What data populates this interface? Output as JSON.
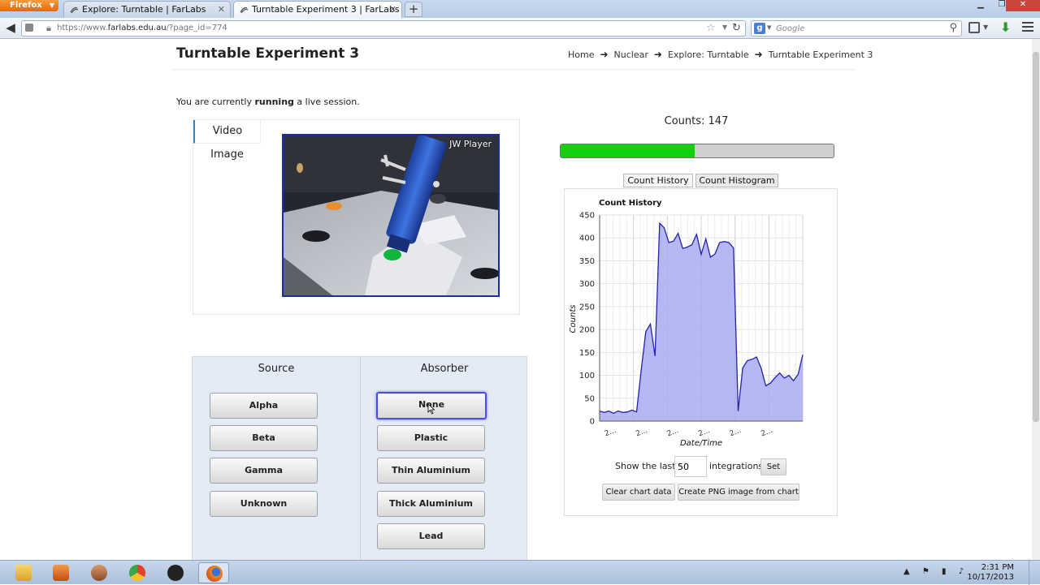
{
  "browser": {
    "app_button": "Firefox",
    "tabs": [
      {
        "title": "Explore: Turntable | FarLabs",
        "active": false
      },
      {
        "title": "Turntable Experiment 3 | FarLabs",
        "active": true
      }
    ],
    "url_prefix": "https://www.",
    "url_domain": "farlabs.edu.au",
    "url_rest": "/?page_id=774",
    "search_placeholder": "Google",
    "search_engine_letter": "g"
  },
  "page": {
    "title": "Turntable Experiment 3",
    "breadcrumb": [
      "Home",
      "Nuclear",
      "Explore: Turntable",
      "Turntable Experiment 3"
    ],
    "session_prefix": "You are currently ",
    "session_state": "running",
    "session_suffix": " a live session."
  },
  "media": {
    "tabs": [
      "Video",
      "Image"
    ],
    "active_tab": "Video",
    "player_label": "JW Player"
  },
  "controls": {
    "source_title": "Source",
    "absorber_title": "Absorber",
    "sources": [
      "Alpha",
      "Beta",
      "Gamma",
      "Unknown"
    ],
    "absorbers": [
      "None",
      "Plastic",
      "Thin Aluminium",
      "Thick Aluminium",
      "Lead"
    ],
    "selected_absorber": "None"
  },
  "counts": {
    "label": "Counts: 147",
    "progress_fraction": 0.49,
    "progress_color": "#10d010"
  },
  "chart_tabs": [
    "Count History",
    "Count Histogram"
  ],
  "chart_data": {
    "type": "area",
    "title": "Count History",
    "xlabel": "Date/Time",
    "ylabel": "Counts",
    "ylim": [
      0,
      450
    ],
    "yticks": [
      0,
      50,
      100,
      150,
      200,
      250,
      300,
      350,
      400,
      450
    ],
    "xtick_labels": [
      "2...",
      "2...",
      "2...",
      "2...",
      "2...",
      "2..."
    ],
    "fill_color": "#a9abf2",
    "line_color": "#2323a8",
    "series": [
      {
        "values": [
          22,
          19,
          22,
          17,
          22,
          19,
          20,
          24,
          20,
          110,
          195,
          212,
          142,
          432,
          422,
          390,
          393,
          410,
          377,
          380,
          385,
          408,
          364,
          398,
          358,
          365,
          390,
          392,
          390,
          378,
          22,
          116,
          132,
          135,
          140,
          115,
          77,
          83,
          95,
          105,
          94,
          100,
          88,
          102,
          145
        ]
      }
    ]
  },
  "integrations": {
    "label_before": "Show the last",
    "value": "50",
    "label_after": "integrations",
    "set_label": "Set",
    "clear_label": "Clear chart data",
    "png_label": "Create PNG image from chart"
  },
  "taskbar": {
    "time": "2:31 PM",
    "date": "10/17/2013"
  }
}
